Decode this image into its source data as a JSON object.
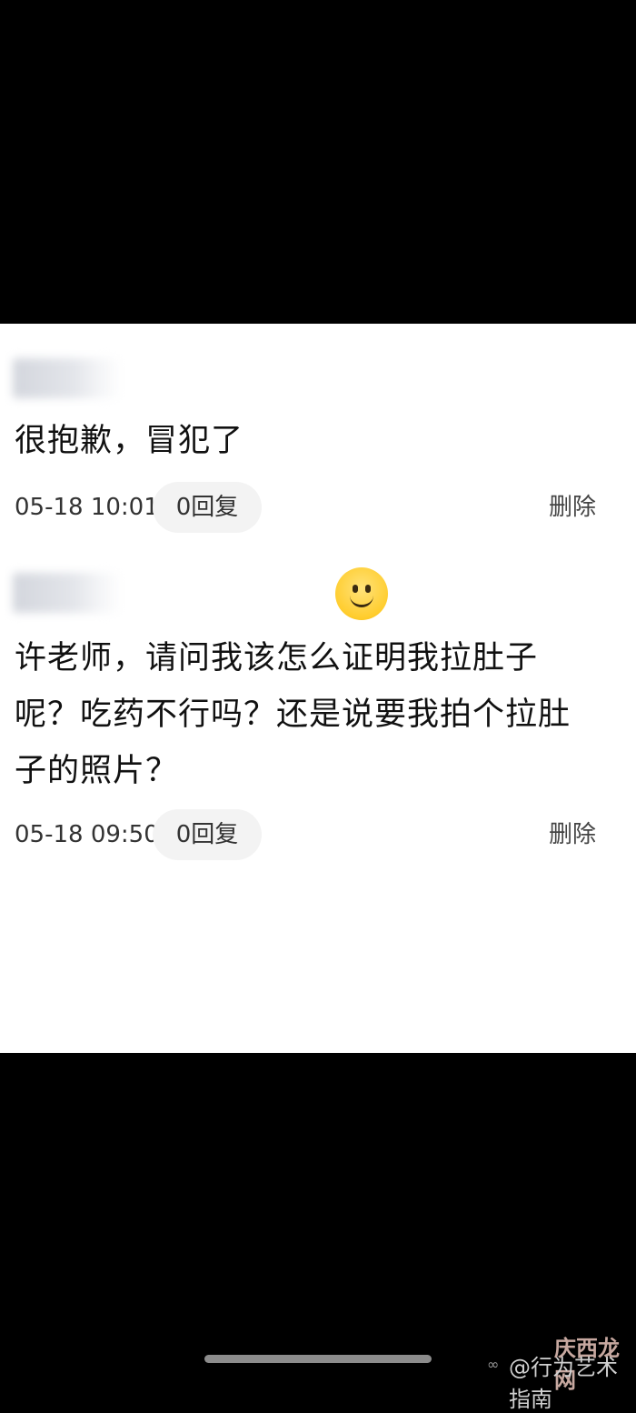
{
  "comments": [
    {
      "text": "很抱歉，冒犯了",
      "time": "05-18 10:01",
      "reply": "0回复",
      "delete": "删除"
    },
    {
      "text": "许老师，请问我该怎么证明我拉肚子呢？吃药不行吗？还是说要我拍个拉肚子的照片？",
      "time": "05-18 09:50",
      "reply": "0回复",
      "delete": "删除"
    }
  ],
  "emoji": "slightly-smiling-face",
  "watermark": {
    "bird": "∞",
    "handle": "@行为艺术指南",
    "site": "庆西龙网"
  },
  "colors": {
    "background": "#000000",
    "panel": "#ffffff",
    "pill": "#f3f3f3"
  }
}
